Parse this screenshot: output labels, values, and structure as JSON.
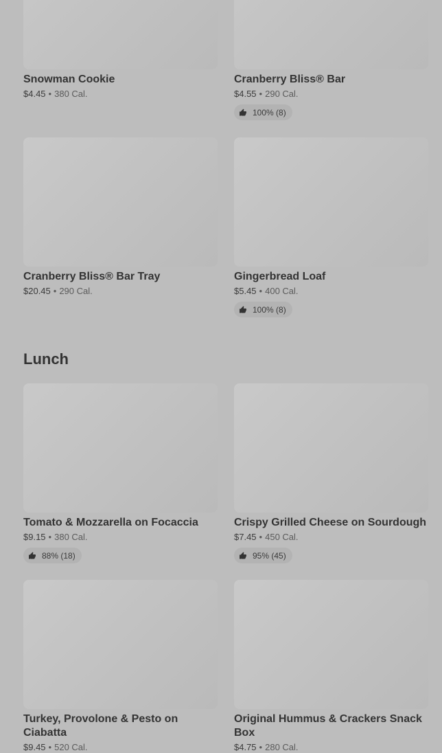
{
  "sections": {
    "lunch_title": "Lunch"
  },
  "items": [
    {
      "name": "Snowman Cookie",
      "price": "$4.45",
      "calories": "380 Cal.",
      "rating": ""
    },
    {
      "name": "Cranberry Bliss® Bar",
      "price": "$4.55",
      "calories": "290 Cal.",
      "rating": "100% (8)"
    },
    {
      "name": "Cranberry Bliss® Bar Tray",
      "price": "$20.45",
      "calories": "290 Cal.",
      "rating": ""
    },
    {
      "name": "Gingerbread Loaf",
      "price": "$5.45",
      "calories": "400 Cal.",
      "rating": "100% (8)"
    },
    {
      "name": "Tomato & Mozzarella on Focaccia",
      "price": "$9.15",
      "calories": "380 Cal.",
      "rating": "88% (18)"
    },
    {
      "name": "Crispy Grilled Cheese on Sourdough",
      "price": "$7.45",
      "calories": "450 Cal.",
      "rating": "95% (45)"
    },
    {
      "name": "Turkey, Provolone & Pesto on Ciabatta",
      "price": "$9.45",
      "calories": "520 Cal.",
      "rating": ""
    },
    {
      "name": "Original Hummus & Crackers Snack Box",
      "price": "$4.75",
      "calories": "280 Cal.",
      "rating": ""
    }
  ]
}
